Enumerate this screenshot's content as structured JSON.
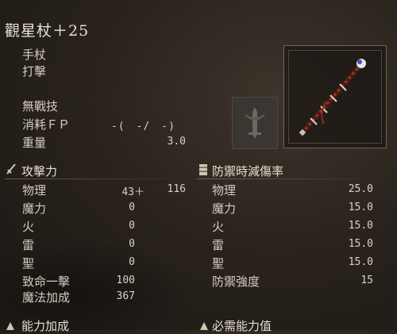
{
  "weapon": {
    "name": "觀星杖＋25",
    "type": "手杖",
    "damage_type": "打擊",
    "skill": "無戰技",
    "fp_label": "消耗ＦＰ",
    "fp_value": "-(　-/　-)",
    "weight_label": "重量",
    "weight_value": "3.0"
  },
  "icons": {
    "ash_of_war": "sword-emblem-icon",
    "weapon": "staff-icon",
    "attack": "sword-icon",
    "defense": "shield-icon",
    "attribute_scaling": "scaling-icon",
    "attribute_requirement": "requirement-icon"
  },
  "attack": {
    "header": "攻擊力",
    "rows": [
      {
        "label": "物理",
        "base": "43＋",
        "total": "116"
      },
      {
        "label": "魔力",
        "base": "0"
      },
      {
        "label": "火",
        "base": "0"
      },
      {
        "label": "雷",
        "base": "0"
      },
      {
        "label": "聖",
        "base": "0"
      },
      {
        "label": "致命一擊",
        "base": "100"
      },
      {
        "label": "魔法加成",
        "base": "367"
      }
    ]
  },
  "defense": {
    "header": "防禦時減傷率",
    "rows": [
      {
        "label": "物理",
        "value": "25.0"
      },
      {
        "label": "魔力",
        "value": "15.0"
      },
      {
        "label": "火",
        "value": "15.0"
      },
      {
        "label": "雷",
        "value": "15.0"
      },
      {
        "label": "聖",
        "value": "15.0"
      },
      {
        "label": "防禦強度",
        "value": "15"
      }
    ]
  },
  "footer": {
    "left_header": "能力加成",
    "right_header": "必需能力值"
  }
}
